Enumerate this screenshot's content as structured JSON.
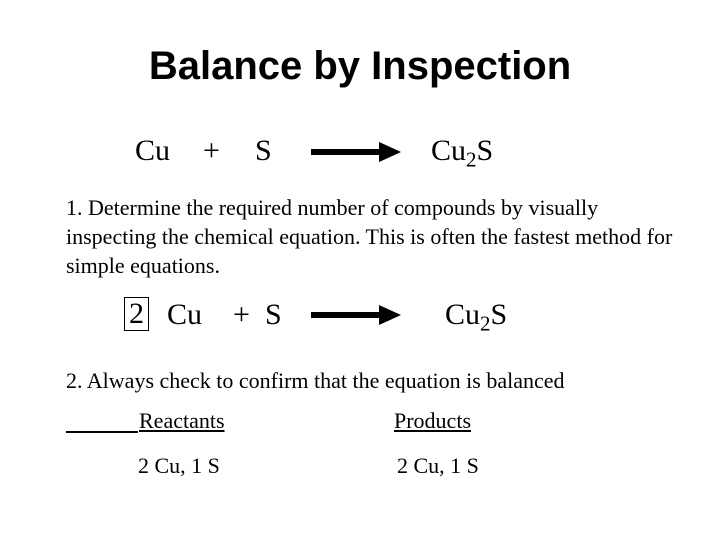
{
  "title": "Balance by Inspection",
  "equation1": {
    "reactant1": "Cu",
    "plus": "+",
    "reactant2": "S",
    "product_base": "Cu",
    "product_sub": "2",
    "product_tail": "S"
  },
  "step1": "1.  Determine the required number of compounds by visually inspecting the chemical equation.  This is often the fastest method for simple equations.",
  "equation2": {
    "coefficient": "2",
    "reactant1": "Cu",
    "plus": "+ ",
    "reactant2": "S",
    "product_base": "Cu",
    "product_sub": "2",
    "product_tail": "S"
  },
  "step2": "2.  Always check to confirm that the equation is balanced",
  "table": {
    "reactants_header": "Reactants",
    "products_header": "Products",
    "reactants_value": "2 Cu, 1 S",
    "products_value": "2 Cu, 1 S"
  }
}
